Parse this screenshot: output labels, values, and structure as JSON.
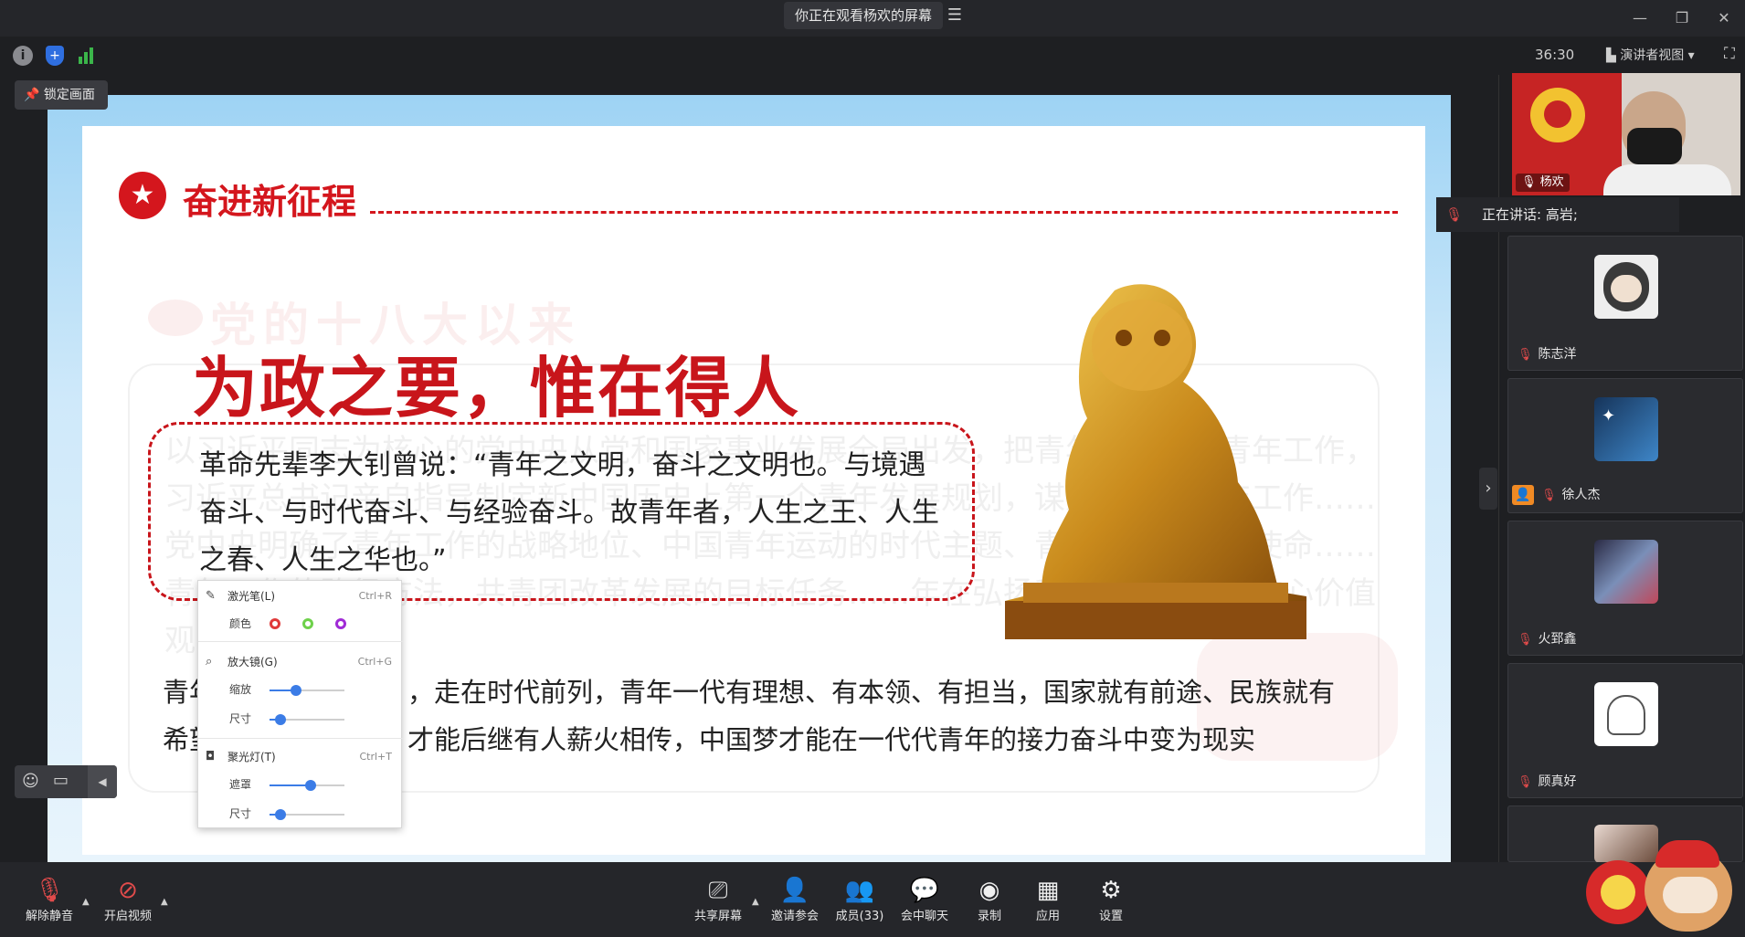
{
  "topbar": {
    "viewing_label": "你正在观看杨欢的屏幕",
    "menu_icon": "list-icon",
    "window_controls": [
      "minimize-icon",
      "restore-icon",
      "close-icon"
    ]
  },
  "status": {
    "timer": "36:30",
    "view_mode": "演讲者视图",
    "icons": [
      "info-icon",
      "shield-icon",
      "signal-icon",
      "fullscreen-icon"
    ]
  },
  "lock_button": {
    "label": "锁定画面"
  },
  "slide": {
    "heading": "奋进新征程",
    "ghost_title": "党的十八大以来",
    "big_title": "为政之要，惟在得人",
    "quote": "革命先辈李大钊曾说：“青年之文明，奋斗之文明也。与境遇奋斗、与时代奋斗、与经验奋斗。故青年者，人生之王、人生之春、人生之华也。”",
    "ghost_text": "以习近平同志为核心的党中央从党和国家事业发展全局出发，把青年工作……青年工作，习近平总书记亲自指导制定新中国历史上第一个青年发展规划，谋划和推进青年工作……党中央明确了青年工作的战略地位、中国青年运动的时代主题、青年工作的职责使命……青年工作的路径方法，共青团改革发展的目标任务……年在弘扬和践行社会主义核心价值观中勤学、修",
    "body_line1": "青年▊▊▊▊▊▊▊▊▊同，走在时代前列，青年一代有理想、有本领、有担当，国家就有前途、民族就有",
    "body_line1_visible_start": "青年",
    "body_line1_visible_end": "，走在时代前列，青年一代有理想、有本领、有担当，国家就有前途、民族就有",
    "body_line2_visible_start": "希望",
    "body_line2_visible_end": "才能后继有人薪火相传，中国梦才能在一代代青年的接力奋斗中变为现实"
  },
  "tool_panel": {
    "laser": {
      "label": "激光笔(L)",
      "shortcut": "Ctrl+R",
      "color_label": "颜色",
      "colors": [
        "#e03a3a",
        "#6ed14a",
        "#a02bd6"
      ]
    },
    "magnifier": {
      "label": "放大镜(G)",
      "shortcut": "Ctrl+G",
      "zoom_label": "缩放",
      "zoom_level": 0.35,
      "size_label": "尺寸",
      "size_level": 0.15
    },
    "spotlight": {
      "label": "聚光灯(T)",
      "shortcut": "Ctrl+T",
      "mask_label": "遮罩",
      "mask_level": 0.55,
      "size_label": "尺寸",
      "size_level": 0.15
    }
  },
  "mini_toolbar": {
    "icons": [
      "emoji-icon",
      "comment-icon",
      "collapse-left-icon"
    ]
  },
  "participants": {
    "main_speaker": "杨欢",
    "speaking_now": "正在讲话: 高岩;",
    "tiles": [
      {
        "name": "陈志洋",
        "muted": true
      },
      {
        "name": "徐人杰",
        "muted": true,
        "badge": "host-badge-icon"
      },
      {
        "name": "火郅鑫",
        "muted": true
      },
      {
        "name": "顾真好",
        "muted": true
      }
    ]
  },
  "bottombar": {
    "items": [
      {
        "label": "解除静音",
        "icon": "mic-muted-icon"
      },
      {
        "label": "开启视频",
        "icon": "video-off-icon"
      },
      {
        "label": "共享屏幕",
        "icon": "share-screen-icon"
      },
      {
        "label": "邀请参会",
        "icon": "invite-icon"
      },
      {
        "label": "成员(33)",
        "icon": "members-icon"
      },
      {
        "label": "会中聊天",
        "icon": "chat-icon"
      },
      {
        "label": "录制",
        "icon": "record-icon"
      },
      {
        "label": "应用",
        "icon": "apps-icon"
      },
      {
        "label": "设置",
        "icon": "settings-icon"
      }
    ]
  }
}
